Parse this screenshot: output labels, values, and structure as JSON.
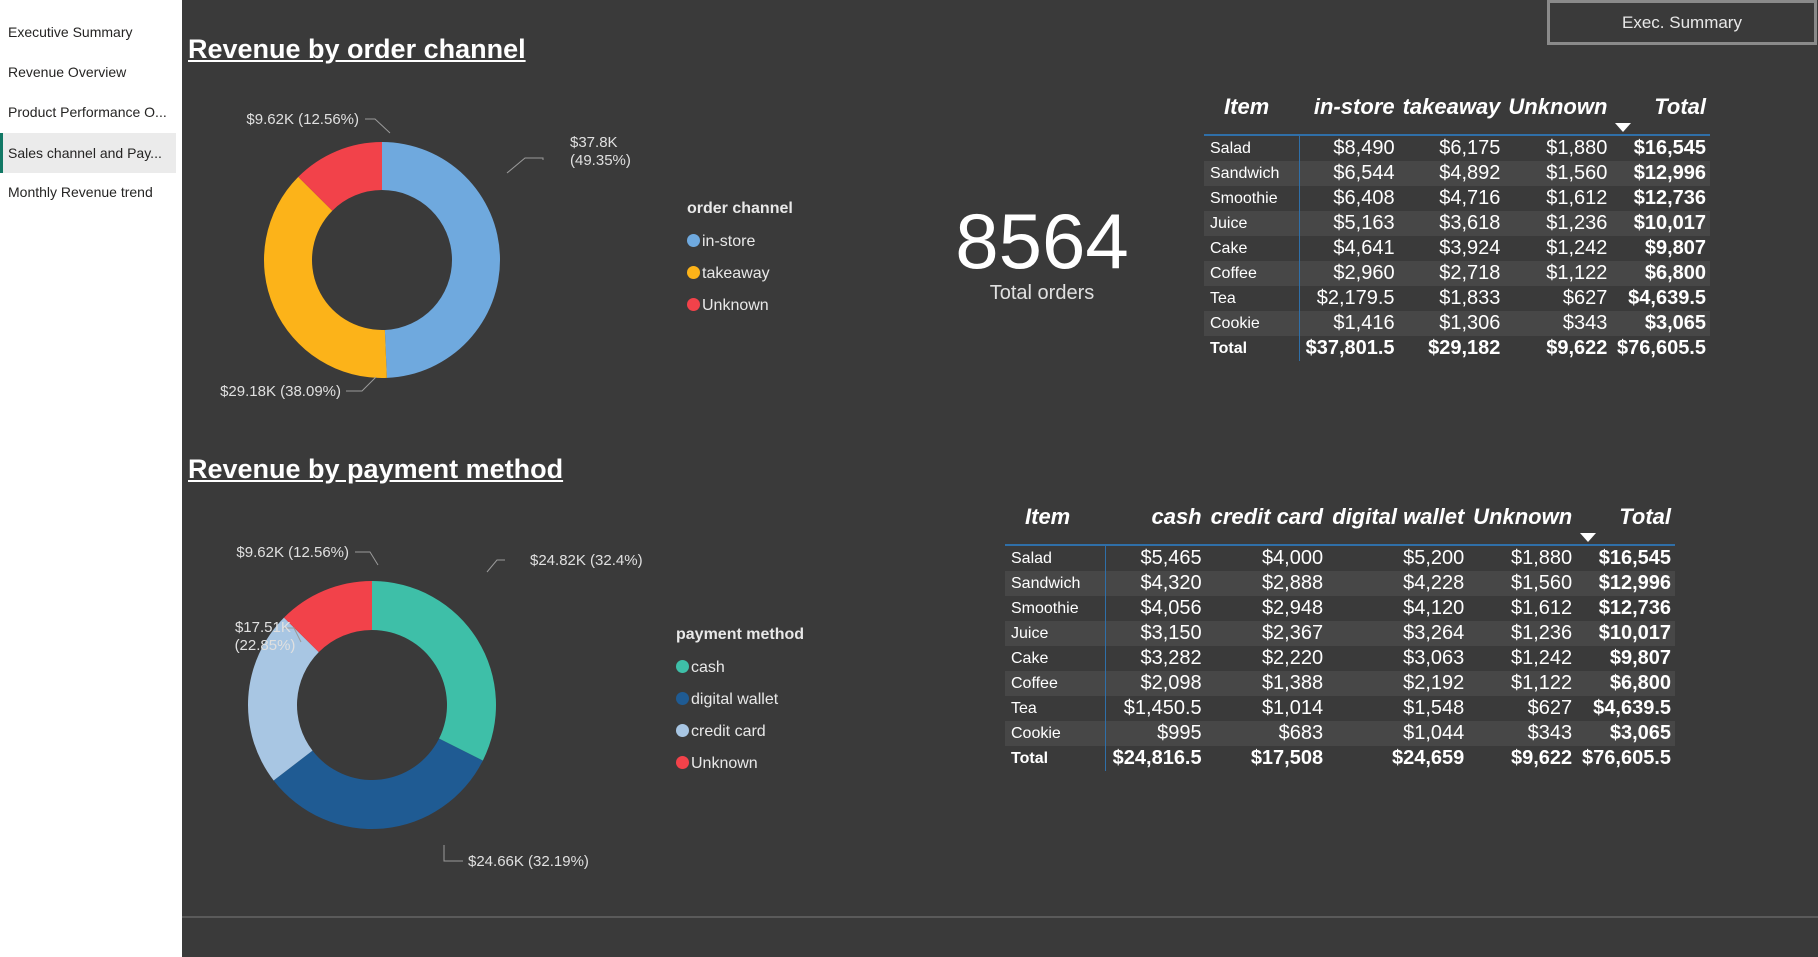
{
  "nav": {
    "items": [
      {
        "label": "Executive Summary",
        "active": false
      },
      {
        "label": "Revenue Overview",
        "active": false
      },
      {
        "label": "Product Performance O...",
        "active": false
      },
      {
        "label": "Sales channel and Pay...",
        "active": true
      },
      {
        "label": "Monthly Revenue trend",
        "active": false
      }
    ]
  },
  "header": {
    "exec_button": "Exec. Summary"
  },
  "colors": {
    "background": "#3a3a3a",
    "in_store": "#6fa9de",
    "takeaway": "#fcb319",
    "unknown": "#f2424a",
    "cash": "#3ebfa8",
    "digital_wallet": "#1f5b93",
    "credit_card": "#a8c6e3",
    "active_nav": "#117865"
  },
  "order_channel": {
    "title": "Revenue by order channel",
    "legend_title": "order channel",
    "labels": {
      "in_store": [
        "$37.8K",
        "(49.35%)"
      ],
      "takeaway": [
        "$29.18K (38.09%)"
      ],
      "unknown": [
        "$9.62K (12.56%)"
      ]
    }
  },
  "payment_method": {
    "title": "Revenue by payment method",
    "legend_title": "payment method",
    "labels": {
      "cash": [
        "$24.82K (32.4%)"
      ],
      "digital_wallet": [
        "$24.66K (32.19%)"
      ],
      "credit_card": [
        "$17.51K",
        "(22.85%)"
      ],
      "unknown": [
        "$9.62K (12.56%)"
      ]
    }
  },
  "kpi": {
    "value": "8564",
    "label": "Total orders"
  },
  "chart_data": [
    {
      "type": "pie",
      "title": "Revenue by order channel",
      "legend": "right",
      "categories": [
        "in-store",
        "takeaway",
        "Unknown"
      ],
      "legend_order": [
        "in-store",
        "takeaway",
        "Unknown"
      ],
      "values": [
        37801.5,
        29182,
        9622
      ],
      "percent": [
        49.35,
        38.09,
        12.56
      ],
      "colors": [
        "#6fa9de",
        "#fcb319",
        "#f2424a"
      ]
    },
    {
      "type": "pie",
      "title": "Revenue by payment method",
      "legend": "right",
      "categories": [
        "cash",
        "digital wallet",
        "credit card",
        "Unknown"
      ],
      "legend_order": [
        "cash",
        "digital wallet",
        "credit card",
        "Unknown"
      ],
      "values": [
        24816.5,
        24659,
        17508,
        9622
      ],
      "percent": [
        32.4,
        32.19,
        22.85,
        12.56
      ],
      "colors": [
        "#3ebfa8",
        "#1f5b93",
        "#a8c6e3",
        "#f2424a"
      ]
    }
  ],
  "table_channel": {
    "headers": [
      "Item",
      "in-store",
      "takeaway",
      "Unknown",
      "Total"
    ],
    "rows": [
      [
        "Salad",
        "$8,490",
        "$6,175",
        "$1,880",
        "$16,545"
      ],
      [
        "Sandwich",
        "$6,544",
        "$4,892",
        "$1,560",
        "$12,996"
      ],
      [
        "Smoothie",
        "$6,408",
        "$4,716",
        "$1,612",
        "$12,736"
      ],
      [
        "Juice",
        "$5,163",
        "$3,618",
        "$1,236",
        "$10,017"
      ],
      [
        "Cake",
        "$4,641",
        "$3,924",
        "$1,242",
        "$9,807"
      ],
      [
        "Coffee",
        "$2,960",
        "$2,718",
        "$1,122",
        "$6,800"
      ],
      [
        "Tea",
        "$2,179.5",
        "$1,833",
        "$627",
        "$4,639.5"
      ],
      [
        "Cookie",
        "$1,416",
        "$1,306",
        "$343",
        "$3,065"
      ]
    ],
    "total": [
      "Total",
      "$37,801.5",
      "$29,182",
      "$9,622",
      "$76,605.5"
    ]
  },
  "table_payment": {
    "headers": [
      "Item",
      "cash",
      "credit card",
      "digital wallet",
      "Unknown",
      "Total"
    ],
    "rows": [
      [
        "Salad",
        "$5,465",
        "$4,000",
        "$5,200",
        "$1,880",
        "$16,545"
      ],
      [
        "Sandwich",
        "$4,320",
        "$2,888",
        "$4,228",
        "$1,560",
        "$12,996"
      ],
      [
        "Smoothie",
        "$4,056",
        "$2,948",
        "$4,120",
        "$1,612",
        "$12,736"
      ],
      [
        "Juice",
        "$3,150",
        "$2,367",
        "$3,264",
        "$1,236",
        "$10,017"
      ],
      [
        "Cake",
        "$3,282",
        "$2,220",
        "$3,063",
        "$1,242",
        "$9,807"
      ],
      [
        "Coffee",
        "$2,098",
        "$1,388",
        "$2,192",
        "$1,122",
        "$6,800"
      ],
      [
        "Tea",
        "$1,450.5",
        "$1,014",
        "$1,548",
        "$627",
        "$4,639.5"
      ],
      [
        "Cookie",
        "$995",
        "$683",
        "$1,044",
        "$343",
        "$3,065"
      ]
    ],
    "total": [
      "Total",
      "$24,816.5",
      "$17,508",
      "$24,659",
      "$9,622",
      "$76,605.5"
    ]
  }
}
